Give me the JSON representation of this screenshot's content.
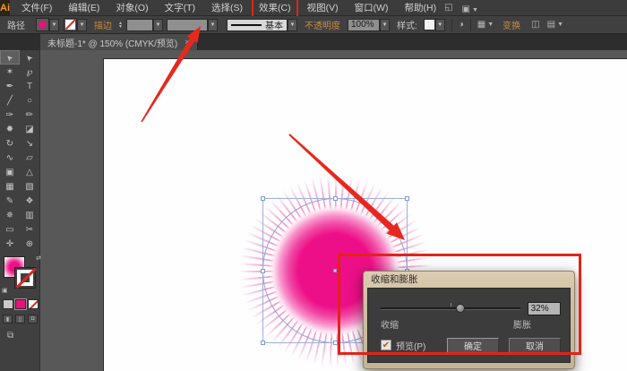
{
  "window": {
    "logo": "Ai"
  },
  "menu_bar": {
    "items": [
      {
        "label": "文件(F)"
      },
      {
        "label": "编辑(E)"
      },
      {
        "label": "对象(O)"
      },
      {
        "label": "文字(T)"
      },
      {
        "label": "选择(S)"
      },
      {
        "label": "效果(C)",
        "highlighted": true
      },
      {
        "label": "视图(V)"
      },
      {
        "label": "窗口(W)"
      },
      {
        "label": "帮助(H)"
      }
    ],
    "right_icons": [
      {
        "name": "arrange-documents-icon",
        "glyph": "◱"
      },
      {
        "name": "workspace-switcher-icon",
        "glyph": "▣"
      }
    ]
  },
  "control_bar": {
    "path_label": "路径",
    "stroke_label": "描边",
    "brush_label": "基本",
    "opacity_label": "不透明度",
    "opacity_value": "100%",
    "style_label": "样式:",
    "transform_label": "变换",
    "sphere_icon_glyph": "◑",
    "grid_icon_glyph": "▦",
    "arrange_icon_glyph": "◫",
    "options_icon_glyph": "▤"
  },
  "tab_bar": {
    "title": "未标题-1* @ 150% (CMYK/预览)",
    "close_glyph": "×"
  },
  "toolbar": {
    "tools": [
      {
        "name": "selection",
        "glyph": "➤",
        "selected": true
      },
      {
        "name": "direct-selection",
        "glyph": "➤"
      },
      {
        "name": "magic-wand",
        "glyph": "✶"
      },
      {
        "name": "lasso",
        "glyph": "℘"
      },
      {
        "name": "pen",
        "glyph": "✒"
      },
      {
        "name": "type",
        "glyph": "T"
      },
      {
        "name": "line-segment",
        "glyph": "╱"
      },
      {
        "name": "ellipse",
        "glyph": "○"
      },
      {
        "name": "paintbrush",
        "glyph": "✑"
      },
      {
        "name": "pencil",
        "glyph": "✏"
      },
      {
        "name": "blob-brush",
        "glyph": "✹"
      },
      {
        "name": "eraser",
        "glyph": "◪"
      },
      {
        "name": "rotate",
        "glyph": "↻"
      },
      {
        "name": "scale",
        "glyph": "↘"
      },
      {
        "name": "width",
        "glyph": "∿"
      },
      {
        "name": "free-transform",
        "glyph": "▱"
      },
      {
        "name": "shape-builder",
        "glyph": "▣"
      },
      {
        "name": "perspective-grid",
        "glyph": "△"
      },
      {
        "name": "mesh",
        "glyph": "▦"
      },
      {
        "name": "gradient",
        "glyph": "▧"
      },
      {
        "name": "eyedropper",
        "glyph": "✎"
      },
      {
        "name": "blend",
        "glyph": "❖"
      },
      {
        "name": "symbol-sprayer",
        "glyph": "✵"
      },
      {
        "name": "column-graph",
        "glyph": "▥"
      },
      {
        "name": "artboard",
        "glyph": "▭"
      },
      {
        "name": "slice",
        "glyph": "✂"
      },
      {
        "name": "hand",
        "glyph": "✛"
      },
      {
        "name": "zoom",
        "glyph": "⊕"
      }
    ]
  },
  "dialog": {
    "title": "收缩和膨胀",
    "pucker_label": "收缩",
    "bloat_label": "膨胀",
    "value": "32%",
    "slider_percent": 57,
    "preview_checked": true,
    "check_glyph": "✔",
    "preview_label": "预览(P)",
    "ok_label": "确定",
    "cancel_label": "取消"
  },
  "colors": {
    "annotation_red": "#e02419",
    "artwork_magenta": "#ec1086",
    "selection_blue": "#93aadc",
    "link_amber": "#c98a3e"
  }
}
